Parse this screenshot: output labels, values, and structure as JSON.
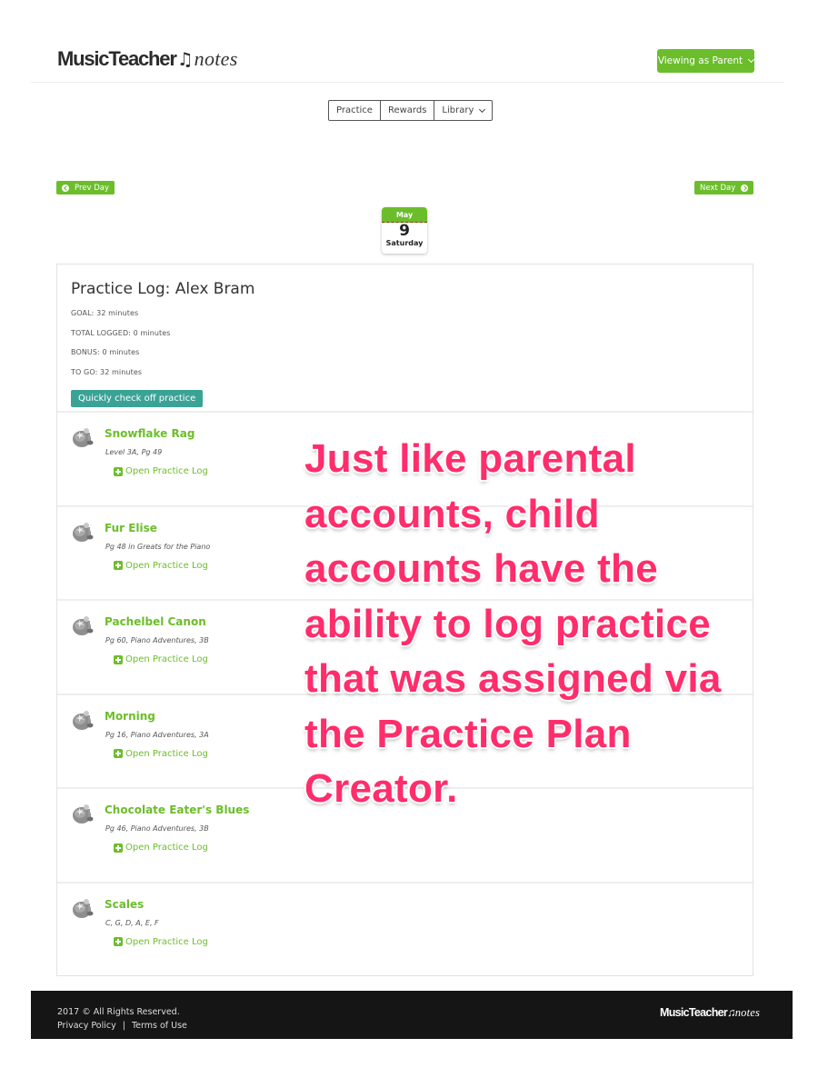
{
  "header": {
    "logo_part1": "MusicTeacher",
    "logo_note": "♫",
    "logo_part2": "notes",
    "viewing_label": "Viewing as Parent"
  },
  "nav": {
    "tabs": [
      {
        "label": "Practice"
      },
      {
        "label": "Rewards"
      },
      {
        "label": "Library",
        "has_dropdown": true
      }
    ]
  },
  "day_nav": {
    "prev_label": "Prev Day",
    "next_label": "Next Day"
  },
  "calendar": {
    "month": "May",
    "day": "9",
    "weekday": "Saturday"
  },
  "practice_log": {
    "title": "Practice Log: Alex Bram",
    "goal": "GOAL: 32 minutes",
    "total_logged": "TOTAL LOGGED: 0 minutes",
    "bonus": "BONUS: 0 minutes",
    "to_go": "TO GO: 32 minutes",
    "quick_check_label": "Quickly check off practice",
    "open_log_label": "Open Practice Log",
    "pieces": [
      {
        "title": "Snowflake Rag",
        "subtitle": "Level 3A, Pg 49"
      },
      {
        "title": "Fur Elise",
        "subtitle": "Pg 48 in Greats for the Piano"
      },
      {
        "title": "Pachelbel Canon",
        "subtitle": "Pg 60, Piano Adventures, 3B"
      },
      {
        "title": "Morning",
        "subtitle": "Pg 16, Piano Adventures, 3A"
      },
      {
        "title": "Chocolate Eater's Blues",
        "subtitle": "Pg 46, Piano Adventures, 3B"
      },
      {
        "title": "Scales",
        "subtitle": "C, G, D, A, E, F"
      }
    ]
  },
  "overlay": {
    "text": "Just like parental accounts, child accounts have the ability to log practice that was assigned via the Practice Plan Creator."
  },
  "footer": {
    "copyright": "2017 © All Rights Reserved.",
    "privacy_label": "Privacy Policy",
    "separator": "|",
    "terms_label": "Terms of Use"
  },
  "colors": {
    "brand_green": "#6cbd2b",
    "teal_button": "#3aa396",
    "annotation_pink": "#ff2d6b",
    "footer_bg": "#151515"
  }
}
